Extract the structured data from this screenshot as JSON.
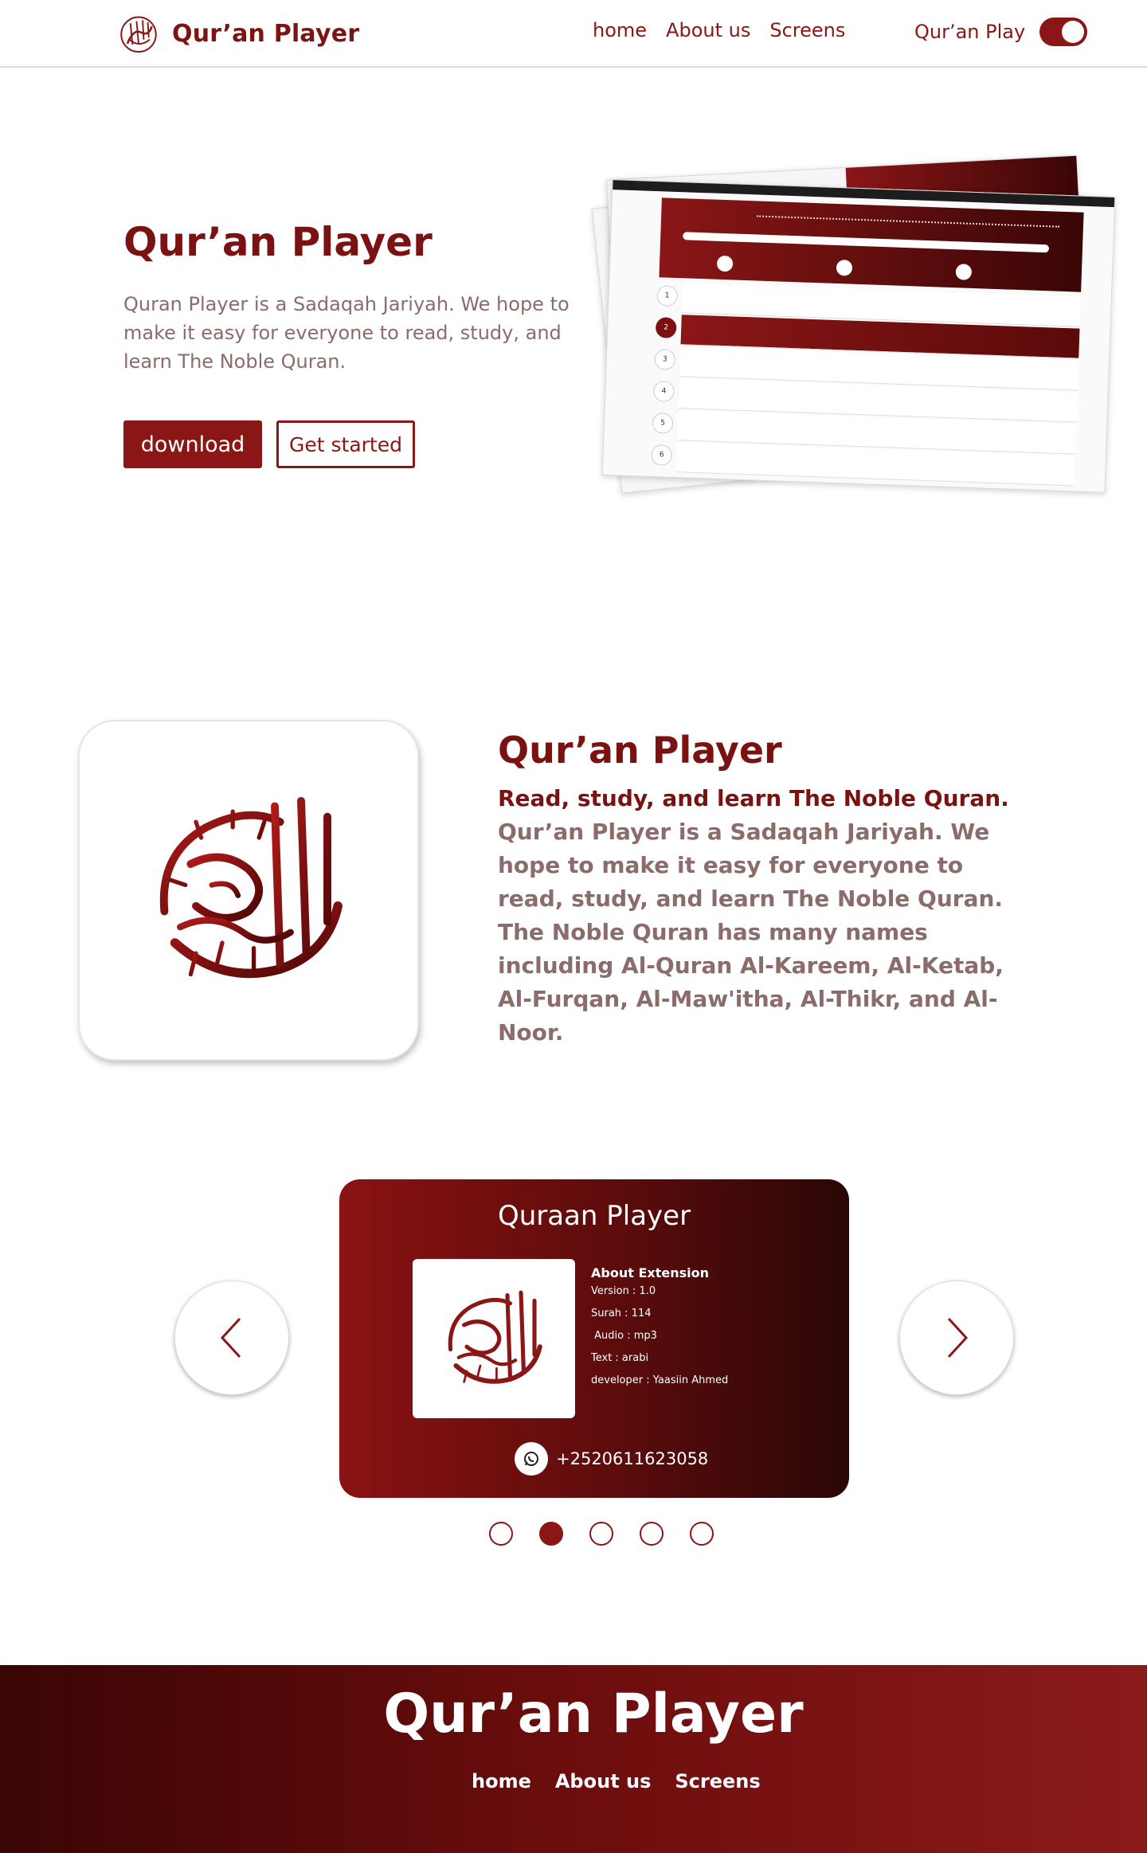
{
  "nav": {
    "brand": "Qur’an Player",
    "links": [
      "home",
      "About us",
      "Screens"
    ],
    "right_label": "Qur’an Play",
    "toggle_on": true
  },
  "hero": {
    "title": "Qur’an Player",
    "description": "Quran Player is a Sadaqah Jariyah. We hope to make it easy for everyone to read, study, and learn The Noble Quran.",
    "download_label": "download",
    "started_label": "Get started"
  },
  "about": {
    "title": "Qur’an Player",
    "subtitle": "Read, study, and learn The Noble Quran.",
    "description": "Qur’an Player is a Sadaqah Jariyah. We hope to make it easy for everyone to read, study, and learn The Noble Quran. The Noble Quran has many names including Al-Quran Al-Kareem, Al-Ketab, Al-Furqan, Al-Maw'itha, Al-Thikr, and Al-Noor."
  },
  "carousel": {
    "title": "Quraan Player",
    "info_heading": "About Extension",
    "info_lines": [
      "Version : 1.0",
      "Surah : 114",
      " Audio : mp3",
      "Text : arabi",
      "developer : Yaasiin Ahmed"
    ],
    "phone": "+2520611623058",
    "active_dot": 1,
    "dot_count": 5
  },
  "footer": {
    "title": "Qur’an Player",
    "links": [
      "home",
      "About us",
      "Screens"
    ]
  },
  "colors": {
    "brand": "#8b1616",
    "text_muted": "#8c6b6b"
  }
}
